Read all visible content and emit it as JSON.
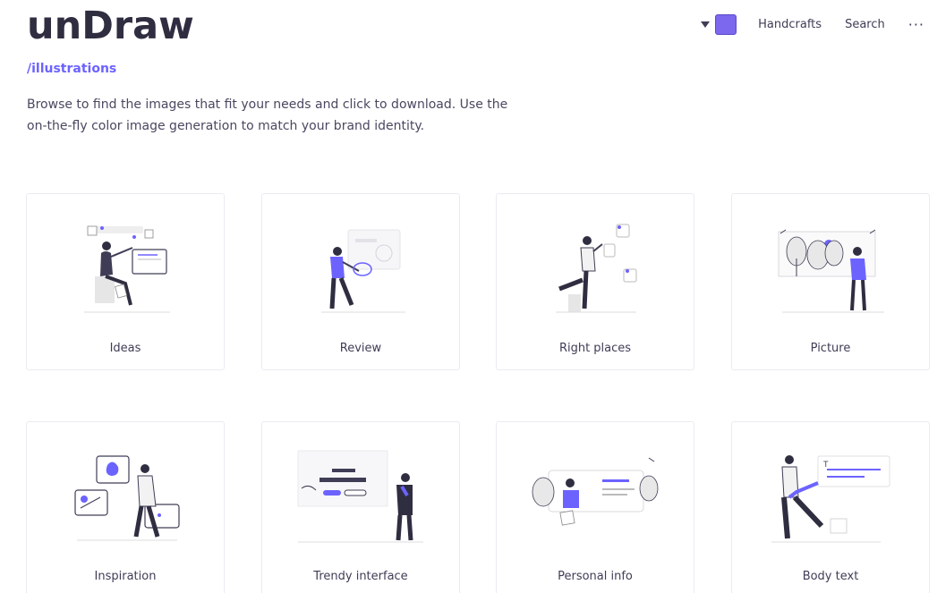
{
  "header": {
    "logo": "unDraw",
    "accent_color": "#7b68ee",
    "nav": {
      "color_caret_icon": "caret-down-icon",
      "handcrafts_label": "Handcrafts",
      "search_label": "Search",
      "more_label": "···"
    }
  },
  "subtitle": "/illustrations",
  "intro": "Browse to find the images that fit your needs and click to download. Use the on-the-fly color image generation to match your brand identity.",
  "cards": [
    {
      "label": "Ideas"
    },
    {
      "label": "Review"
    },
    {
      "label": "Right places"
    },
    {
      "label": "Picture"
    },
    {
      "label": "Inspiration"
    },
    {
      "label": "Trendy interface"
    },
    {
      "label": "Personal info"
    },
    {
      "label": "Body text"
    }
  ]
}
